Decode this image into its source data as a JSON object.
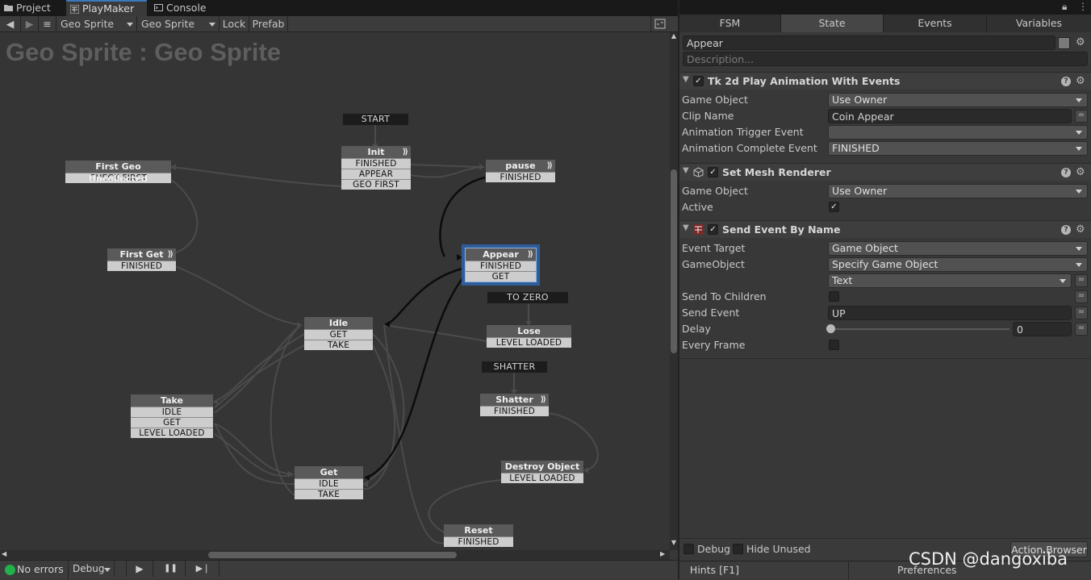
{
  "window": {
    "tabs": [
      {
        "label": "Project",
        "icon": "folder-icon"
      },
      {
        "label": "PlayMaker",
        "icon": "playmaker-icon"
      },
      {
        "label": "Console",
        "icon": "console-icon"
      }
    ]
  },
  "toolbar": {
    "back": "◀",
    "forward": "▶",
    "menu": "≡",
    "gameobject_select": "Geo Sprite",
    "fsm_select": "Geo Sprite",
    "lock_label": "Lock",
    "prefab_label": "Prefab"
  },
  "graph": {
    "title": "Geo Sprite : Geo Sprite",
    "global_transitions": {
      "start": "START",
      "to_zero": "TO ZERO",
      "shatter": "SHATTER"
    },
    "states": {
      "init": {
        "name": "Init",
        "events": [
          "FINISHED",
          "APPEAR",
          "GEO FIRST"
        ]
      },
      "first_geo_uncollected": {
        "name": "First Geo Uncollected",
        "events": [
          "CHECK FIRST"
        ]
      },
      "pause": {
        "name": "pause",
        "events": [
          "FINISHED"
        ]
      },
      "first_get": {
        "name": "First Get",
        "events": [
          "FINISHED"
        ]
      },
      "appear": {
        "name": "Appear",
        "events": [
          "FINISHED",
          "GET"
        ]
      },
      "idle": {
        "name": "Idle",
        "events": [
          "GET",
          "TAKE"
        ]
      },
      "lose": {
        "name": "Lose",
        "events": [
          "LEVEL LOADED"
        ]
      },
      "take": {
        "name": "Take",
        "events": [
          "IDLE",
          "GET",
          "LEVEL LOADED"
        ]
      },
      "shatter": {
        "name": "Shatter",
        "events": [
          "FINISHED"
        ]
      },
      "get": {
        "name": "Get",
        "events": [
          "IDLE",
          "TAKE"
        ]
      },
      "destroy_object": {
        "name": "Destroy Object",
        "events": [
          "LEVEL LOADED"
        ]
      },
      "reset": {
        "name": "Reset",
        "events": [
          "FINISHED"
        ]
      }
    }
  },
  "status": {
    "errors": "No errors",
    "debug_label": "Debug",
    "play": "▶",
    "pause": "❚❚",
    "step": "▶❘",
    "error_color": "#22b14c"
  },
  "inspector": {
    "tabs": [
      "FSM",
      "State",
      "Events",
      "Variables"
    ],
    "active_tab": "State",
    "state_name": "Appear",
    "description_placeholder": "Description...",
    "actions": {
      "tk2d": {
        "title": "Tk 2d Play Animation With Events",
        "fields": {
          "game_object_label": "Game Object",
          "game_object_value": "Use Owner",
          "clip_name_label": "Clip Name",
          "clip_name_value": "Coin Appear",
          "trigger_label": "Animation Trigger Event",
          "trigger_value": "",
          "complete_label": "Animation Complete Event",
          "complete_value": "FINISHED"
        }
      },
      "mesh": {
        "title": "Set Mesh Renderer",
        "fields": {
          "game_object_label": "Game Object",
          "game_object_value": "Use Owner",
          "active_label": "Active",
          "active_checked": true
        }
      },
      "send_event": {
        "title": "Send Event By Name",
        "fields": {
          "event_target_label": "Event Target",
          "event_target_value": "Game Object",
          "gameobject_label": "GameObject",
          "gameobject_value": "Specify Game Object",
          "gameobject_sub_value": "Text",
          "send_children_label": "Send To Children",
          "send_event_label": "Send Event",
          "send_event_value": "UP",
          "delay_label": "Delay",
          "delay_value": "0",
          "every_frame_label": "Every Frame"
        }
      }
    },
    "footer": {
      "debug_label": "Debug",
      "hide_unused_label": "Hide Unused",
      "action_browser_label": "Action Browser"
    },
    "bottom": {
      "hints_label": "Hints [F1]",
      "preferences_label": "Preferences"
    }
  },
  "watermark": "CSDN @dangoxiba"
}
